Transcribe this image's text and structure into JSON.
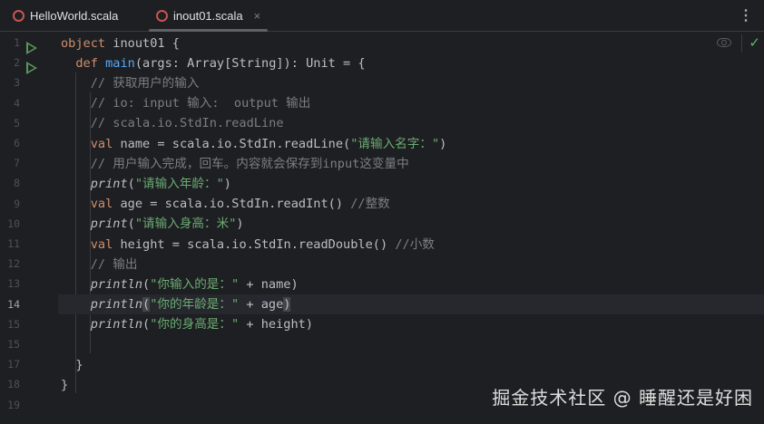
{
  "tabs": [
    {
      "label": "HelloWorld.scala",
      "active": false
    },
    {
      "label": "inout01.scala",
      "active": true
    }
  ],
  "tab_close": "×",
  "more_menu": "⋮",
  "inspection_ok": "✓",
  "current_line": "14",
  "watermark": "掘金技术社区 @ 睡醒还是好困",
  "lines": [
    {
      "n": "1",
      "run": true,
      "tokens": [
        {
          "t": "object ",
          "c": "k"
        },
        {
          "t": "inout01 {"
        }
      ]
    },
    {
      "n": "2",
      "run": true,
      "tokens": [
        {
          "t": "  "
        },
        {
          "t": "def ",
          "c": "k"
        },
        {
          "t": "main",
          "c": "f"
        },
        {
          "t": "(args: Array[String]): Unit = {"
        }
      ]
    },
    {
      "n": "3",
      "tokens": [
        {
          "t": "    "
        },
        {
          "t": "// 获取用户的输入",
          "c": "c"
        }
      ]
    },
    {
      "n": "4",
      "tokens": [
        {
          "t": "    "
        },
        {
          "t": "// io: input 输入:  output 输出",
          "c": "c"
        }
      ]
    },
    {
      "n": "5",
      "tokens": [
        {
          "t": "    "
        },
        {
          "t": "// scala.io.StdIn.readLine",
          "c": "c"
        }
      ]
    },
    {
      "n": "6",
      "tokens": [
        {
          "t": "    "
        },
        {
          "t": "val ",
          "c": "k"
        },
        {
          "t": "name = scala.io.StdIn.readLine("
        },
        {
          "t": "\"请输入名字：\"",
          "c": "s"
        },
        {
          "t": ")"
        }
      ]
    },
    {
      "n": "7",
      "tokens": [
        {
          "t": "    "
        },
        {
          "t": "// 用户输入完成，回车。内容就会保存到input这变量中",
          "c": "c"
        }
      ]
    },
    {
      "n": "8",
      "tokens": [
        {
          "t": "    "
        },
        {
          "t": "print",
          "c": "i"
        },
        {
          "t": "("
        },
        {
          "t": "\"请输入年龄：\"",
          "c": "s"
        },
        {
          "t": ")"
        }
      ]
    },
    {
      "n": "9",
      "tokens": [
        {
          "t": "    "
        },
        {
          "t": "val ",
          "c": "k"
        },
        {
          "t": "age = scala.io.StdIn.readInt() "
        },
        {
          "t": "//整数",
          "c": "c"
        }
      ]
    },
    {
      "n": "10",
      "tokens": [
        {
          "t": "    "
        },
        {
          "t": "print",
          "c": "i"
        },
        {
          "t": "("
        },
        {
          "t": "\"请输入身高：米\"",
          "c": "s"
        },
        {
          "t": ")"
        }
      ]
    },
    {
      "n": "11",
      "tokens": [
        {
          "t": "    "
        },
        {
          "t": "val ",
          "c": "k"
        },
        {
          "t": "height = scala.io.StdIn.readDouble() "
        },
        {
          "t": "//小数",
          "c": "c"
        }
      ]
    },
    {
      "n": "12",
      "tokens": [
        {
          "t": "    "
        },
        {
          "t": "// 输出",
          "c": "c"
        }
      ]
    },
    {
      "n": "13",
      "tokens": [
        {
          "t": "    "
        },
        {
          "t": "println",
          "c": "i"
        },
        {
          "t": "("
        },
        {
          "t": "\"你输入的是：\"",
          "c": "s"
        },
        {
          "t": " + name)"
        }
      ]
    },
    {
      "n": "14",
      "tokens": [
        {
          "t": "    "
        },
        {
          "t": "println",
          "c": "i"
        },
        {
          "t": "(",
          "c": "b"
        },
        {
          "t": "\"你的年龄是：\"",
          "c": "s"
        },
        {
          "t": " + age"
        },
        {
          "t": ")",
          "c": "b"
        }
      ]
    },
    {
      "n": "15",
      "tokens": [
        {
          "t": "    "
        },
        {
          "t": "println",
          "c": "i"
        },
        {
          "t": "("
        },
        {
          "t": "\"你的身高是：\"",
          "c": "s"
        },
        {
          "t": " + height)"
        }
      ]
    },
    {
      "n": "15",
      "tokens": []
    },
    {
      "n": "17",
      "tokens": [
        {
          "t": "  }"
        }
      ]
    },
    {
      "n": "18",
      "tokens": [
        {
          "t": "}"
        }
      ]
    },
    {
      "n": "19",
      "tokens": []
    }
  ]
}
